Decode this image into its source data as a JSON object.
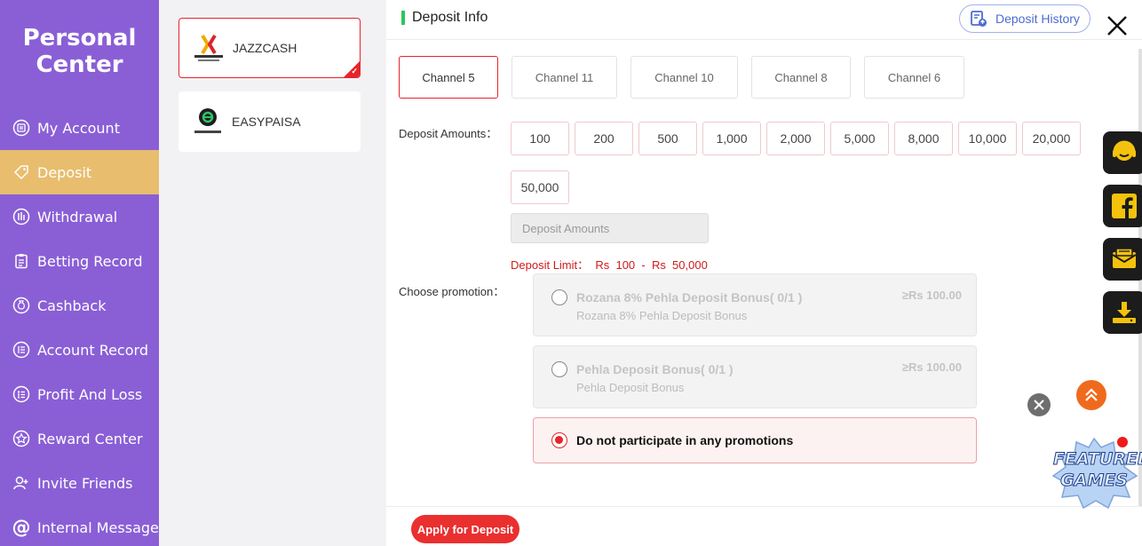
{
  "sidebar": {
    "title_line1": "Personal",
    "title_line2": "Center",
    "items": [
      {
        "label": "My Account",
        "icon": "user-card-icon"
      },
      {
        "label": "Deposit",
        "icon": "deposit-tag-icon"
      },
      {
        "label": "Withdrawal",
        "icon": "withdrawal-icon"
      },
      {
        "label": "Betting Record",
        "icon": "clipboard-icon"
      },
      {
        "label": "Cashback",
        "icon": "money-bag-icon"
      },
      {
        "label": "Account Record",
        "icon": "list-icon"
      },
      {
        "label": "Profit And Loss",
        "icon": "chart-list-icon"
      },
      {
        "label": "Reward Center",
        "icon": "star-icon"
      },
      {
        "label": "Invite Friends",
        "icon": "add-user-icon"
      },
      {
        "label": "Internal Message",
        "icon": "at-icon"
      }
    ],
    "active_index": 1,
    "colors": {
      "background": "#8a5fd6",
      "active": "#e8bd6e"
    }
  },
  "methods": [
    {
      "name": "JAZZCASH",
      "logo": "jazzcash-logo",
      "selected": true
    },
    {
      "name": "EASYPAISA",
      "logo": "easypaisa-logo",
      "selected": false
    }
  ],
  "header": {
    "title": "Deposit Info",
    "history_label": "Deposit History"
  },
  "channels": [
    "Channel 5",
    "Channel 11",
    "Channel 10",
    "Channel 8",
    "Channel 6"
  ],
  "active_channel": 0,
  "deposit": {
    "amounts_label": "Deposit Amounts：",
    "amounts": [
      "100",
      "200",
      "500",
      "1,000",
      "2,000",
      "5,000",
      "8,000",
      "10,000",
      "20,000",
      "50,000"
    ],
    "input_placeholder": "Deposit Amounts",
    "limit_text": "Deposit Limit：  Rs  100  -  Rs  50,000"
  },
  "promotion": {
    "label": "Choose promotion：",
    "options": [
      {
        "title": "Rozana 8% Pehla Deposit Bonus( 0/1 )",
        "subtitle": "Rozana 8% Pehla Deposit Bonus",
        "amount": "≥Rs  100.00",
        "selected": false
      },
      {
        "title": "Pehla Deposit Bonus( 0/1 )",
        "subtitle": "Pehla Deposit Bonus",
        "amount": "≥Rs  100.00",
        "selected": false
      },
      {
        "title": "Do not participate in any promotions",
        "selected": true
      }
    ]
  },
  "footer": {
    "apply_label": "Apply for Deposit"
  },
  "floating": {
    "buttons": [
      "customer-support-icon",
      "facebook-icon",
      "mail-icon",
      "download-icon"
    ],
    "featured_line1": "FEATURED",
    "featured_line2": "GAMES"
  },
  "colors": {
    "accent_red": "#e5252a",
    "apply_button": "#ea2f2f",
    "limit_text": "#d21a1a",
    "header_bar": "#2fc55a",
    "history_blue": "#4e6bd0"
  }
}
